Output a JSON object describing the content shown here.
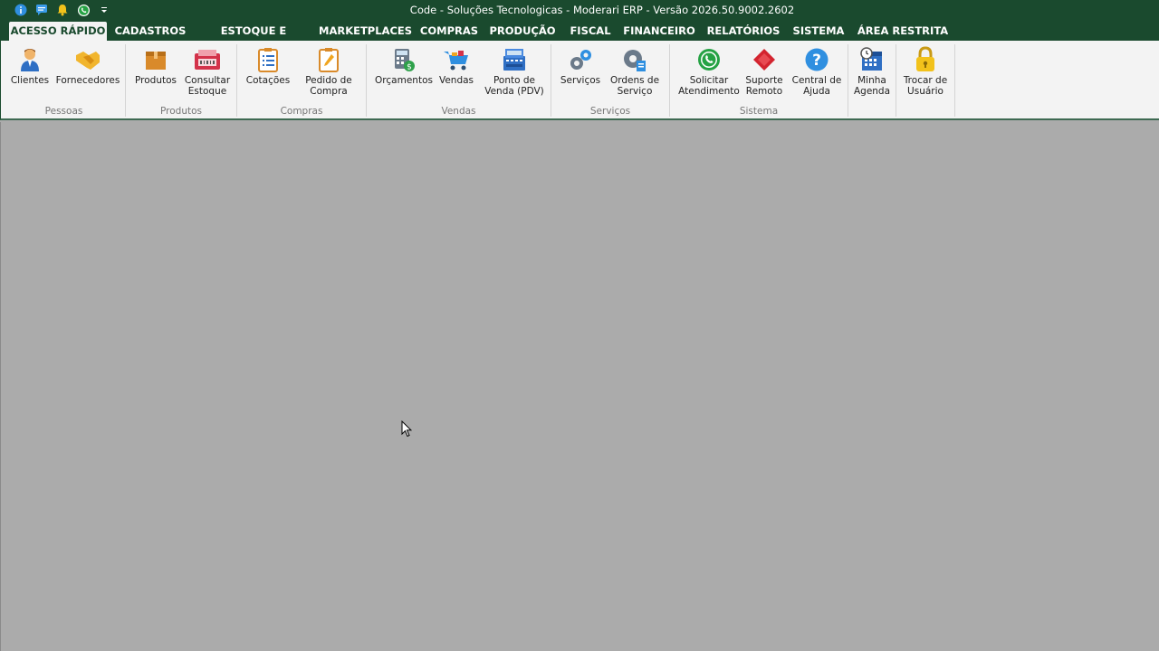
{
  "title_bar": {
    "title": "Code - Soluções Tecnologicas - Moderari ERP - Versão 2026.50.9002.2602",
    "quick_access": [
      "info-icon",
      "chat-icon",
      "bell-icon",
      "whatsapp-icon",
      "customize-dropdown-icon"
    ]
  },
  "menu": {
    "tabs": [
      "ACESSO RÁPIDO",
      "CADASTROS",
      "ESTOQUE E SERVIÇOS",
      "MARKETPLACES",
      "COMPRAS",
      "PRODUÇÃO",
      "FISCAL",
      "FINANCEIRO",
      "RELATÓRIOS",
      "SISTEMA",
      "ÁREA RESTRITA"
    ],
    "active": "ACESSO RÁPIDO"
  },
  "ribbon": {
    "groups": [
      {
        "label": "Pessoas",
        "buttons": [
          {
            "label": "Clientes",
            "icon": "person-icon"
          },
          {
            "label": "Fornecedores",
            "icon": "handshake-icon"
          }
        ]
      },
      {
        "label": "Produtos",
        "buttons": [
          {
            "label": "Produtos",
            "icon": "box-icon"
          },
          {
            "label": "Consultar\nEstoque",
            "icon": "stock-register-icon"
          }
        ]
      },
      {
        "label": "Compras",
        "buttons": [
          {
            "label": "Cotações",
            "icon": "checklist-icon"
          },
          {
            "label": "Pedido de\nCompra",
            "icon": "order-pencil-icon"
          }
        ]
      },
      {
        "label": "Vendas",
        "buttons": [
          {
            "label": "Orçamentos",
            "icon": "calculator-money-icon"
          },
          {
            "label": "Vendas",
            "icon": "cart-icon"
          },
          {
            "label": "Ponto de\nVenda (PDV)",
            "icon": "pos-icon"
          }
        ]
      },
      {
        "label": "Serviços",
        "buttons": [
          {
            "label": "Serviços",
            "icon": "gears-icon"
          },
          {
            "label": "Ordens de\nServiço",
            "icon": "service-order-gear-icon"
          }
        ]
      },
      {
        "label": "Sistema",
        "buttons": [
          {
            "label": "Solicitar\nAtendimento",
            "icon": "whatsapp-icon"
          },
          {
            "label": "Suporte\nRemoto",
            "icon": "remote-support-icon"
          },
          {
            "label": "Central de\nAjuda",
            "icon": "help-icon"
          }
        ]
      },
      {
        "label": "",
        "buttons": [
          {
            "label": "Minha\nAgenda",
            "icon": "calendar-clock-icon"
          }
        ]
      },
      {
        "label": "",
        "buttons": [
          {
            "label": "Trocar de\nUsuário",
            "icon": "padlock-icon"
          }
        ]
      }
    ]
  },
  "colors": {
    "title_bg": "#1a4a2e",
    "ribbon_bg": "#f3f3f3",
    "workspace_bg": "#ababab"
  }
}
